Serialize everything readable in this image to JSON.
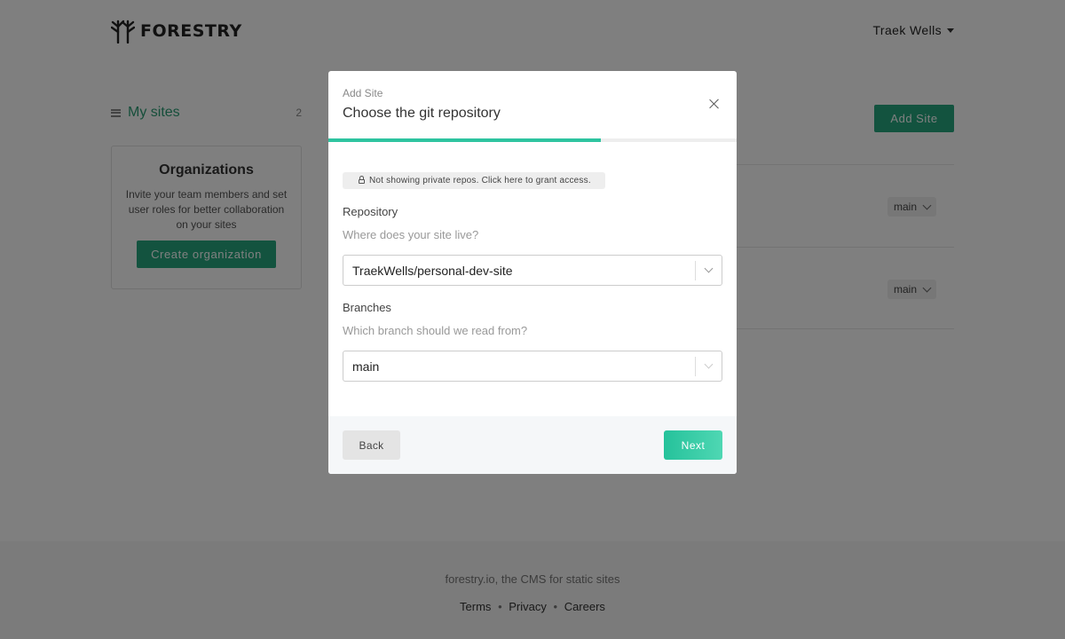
{
  "header": {
    "brand": "FORESTRY",
    "user_name": "Traek Wells"
  },
  "sidebar": {
    "title": "My sites",
    "count": "2"
  },
  "organizations": {
    "title": "Organizations",
    "description": "Invite your team members and set user roles for better collaboration on your sites",
    "button_label": "Create organization"
  },
  "main": {
    "add_site_label": "Add Site",
    "sites": [
      {
        "branch": "main"
      },
      {
        "branch": "main"
      }
    ]
  },
  "modal": {
    "kicker": "Add Site",
    "title": "Choose the git repository",
    "progress_fraction": 0.667,
    "notice": "Not showing private repos. Click here to grant access.",
    "repository": {
      "label": "Repository",
      "hint": "Where does your site live?",
      "value": "TraekWells/personal-dev-site"
    },
    "branches": {
      "label": "Branches",
      "hint": "Which branch should we read from?",
      "value": "main"
    },
    "back_label": "Back",
    "next_label": "Next"
  },
  "footer": {
    "tagline": "forestry.io, the CMS for static sites",
    "links": [
      "Terms",
      "Privacy",
      "Careers"
    ],
    "separator": "•"
  },
  "colors": {
    "brand_green": "#26a67f",
    "accent_teal": "#2ec4a0",
    "overlay": "rgba(0,0,0,0.5)"
  }
}
